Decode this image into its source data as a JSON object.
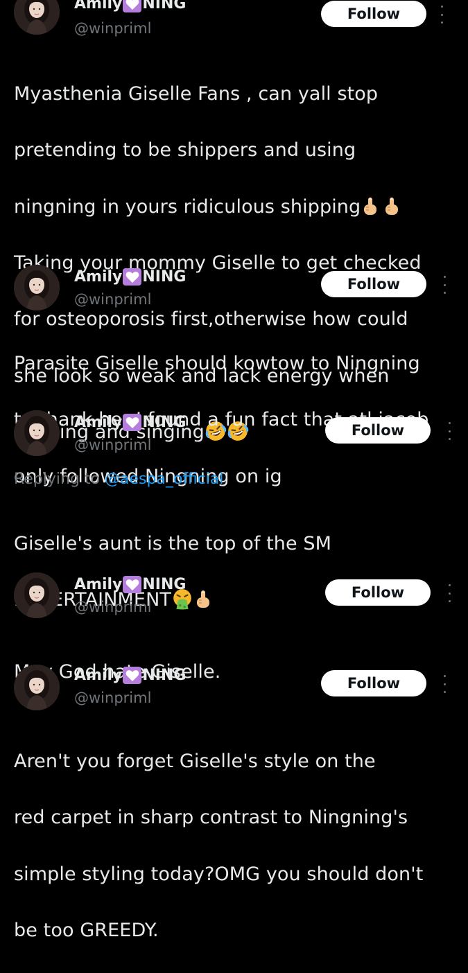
{
  "posts": [
    {
      "name_a": "Amily",
      "name_b": "NING",
      "handle": "@winpriml",
      "follow_label": "Follow",
      "text_lines": [
        "Myasthenia Giselle Fans , can yall stop",
        "pretending to be shippers and  using",
        "ningning in yours ridiculous shipping",
        "Taking your mommy Giselle to get checked",
        "for osteoporosis first,otherwise how could",
        "she look so weak and lack energy when",
        "dancing and singing"
      ]
    },
    {
      "name_a": "Amily",
      "name_b": "NING",
      "handle": "@winpriml",
      "follow_label": "Follow",
      "text_lines": [
        "Parasite Giselle should kowtow to Ningning",
        "to thank her,I found a fun fact that atl jacob",
        "only followed Ningning on ig"
      ]
    },
    {
      "name_a": "Amily",
      "name_b": "NING",
      "handle": "@winpriml",
      "follow_label": "Follow",
      "replying_prefix": "Replying to",
      "replying_mention": "@aespa_official",
      "text_lines": [
        "Giselle's aunt is the top of the SM",
        "ENTERTAINMENT"
      ]
    },
    {
      "name_a": "Amily",
      "name_b": "NING",
      "handle": "@winpriml",
      "follow_label": "Follow",
      "text_lines": [
        "May God hate Giselle."
      ]
    },
    {
      "name_a": "Amily",
      "name_b": "NING",
      "handle": "@winpriml",
      "follow_label": "Follow",
      "text_lines": [
        "Aren't you forget Giselle's style on the",
        "red carpet in sharp contrast to Ningning's",
        "simple styling today?OMG you should don't",
        "be too GREEDY."
      ]
    }
  ],
  "colors": {
    "background": "#000000",
    "text": "#e7e9ea",
    "secondary": "#71767b",
    "link": "#1d9bf0",
    "heart_badge": "#b57edc",
    "follow_bg": "#ffffff"
  },
  "icons": {
    "heart": "purple-heart-icon",
    "more": "more-options-icon",
    "middle_finger": "middle-finger-emoji-icon",
    "laughing": "rolling-laughing-emoji-icon",
    "vomit": "vomiting-face-emoji-icon"
  }
}
